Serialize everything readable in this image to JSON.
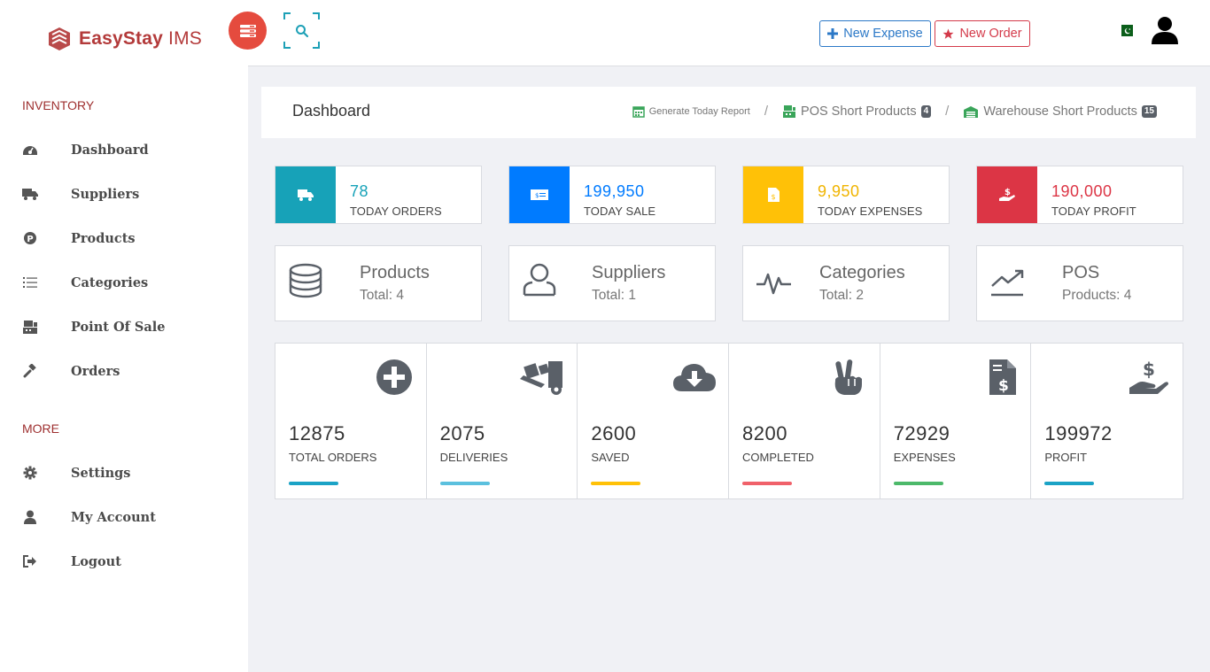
{
  "brand": {
    "name_part1": "EasyStay",
    "name_part2": " IMS"
  },
  "sidebar": {
    "section_inventory": "INVENTORY",
    "section_more": "MORE",
    "inventory_items": [
      {
        "label": "Dashboard",
        "icon": "dashboard-icon"
      },
      {
        "label": "Suppliers",
        "icon": "truck-icon"
      },
      {
        "label": "Products",
        "icon": "product-icon"
      },
      {
        "label": "Categories",
        "icon": "list-icon"
      },
      {
        "label": "Point Of Sale",
        "icon": "pos-icon"
      },
      {
        "label": "Orders",
        "icon": "gavel-icon"
      }
    ],
    "more_items": [
      {
        "label": "Settings",
        "icon": "gear-icon"
      },
      {
        "label": "My Account",
        "icon": "user-icon"
      },
      {
        "label": "Logout",
        "icon": "logout-icon"
      }
    ]
  },
  "header": {
    "new_expense": "New Expense",
    "new_order": "New Order"
  },
  "breadcrumb": {
    "title": "Dashboard",
    "generate_report": "Generate Today Report",
    "pos_short": "POS Short Products",
    "pos_short_count": "4",
    "warehouse_short": "Warehouse Short Products",
    "warehouse_short_count": "15"
  },
  "stats": [
    {
      "value": "78",
      "caption": "TODAY ORDERS",
      "color": "#17a2b8",
      "icon": "truck-icon"
    },
    {
      "value": "199,950",
      "caption": "TODAY SALE",
      "color": "#007bff",
      "icon": "money-icon"
    },
    {
      "value": "9,950",
      "caption": "TODAY EXPENSES",
      "color": "#ffc107",
      "icon": "invoice-icon"
    },
    {
      "value": "190,000",
      "caption": "TODAY PROFIT",
      "color": "#dc3545",
      "icon": "hand-dollar-icon"
    }
  ],
  "info_cards": [
    {
      "name": "Products",
      "sub": "Total: 4",
      "icon": "database-icon"
    },
    {
      "name": "Suppliers",
      "sub": "Total: 1",
      "icon": "user-outline-icon"
    },
    {
      "name": "Categories",
      "sub": "Total: 2",
      "icon": "pulse-icon"
    },
    {
      "name": "POS",
      "sub": "Products: 4",
      "icon": "trend-icon"
    }
  ],
  "metrics": [
    {
      "value": "12875",
      "caption": "TOTAL ORDERS",
      "color": "#1ba3c6",
      "icon": "plus-circle-icon"
    },
    {
      "value": "2075",
      "caption": "DELIVERIES",
      "color": "#5bc0de",
      "icon": "dolly-icon"
    },
    {
      "value": "2600",
      "caption": "SAVED",
      "color": "#ffc107",
      "icon": "cloud-download-icon"
    },
    {
      "value": "8200",
      "caption": "COMPLETED",
      "color": "#f0616a",
      "icon": "peace-hand-icon"
    },
    {
      "value": "72929",
      "caption": "EXPENSES",
      "color": "#4cb96a",
      "icon": "invoice-dollar-icon"
    },
    {
      "value": "199972",
      "caption": "PROFIT",
      "color": "#1ba3c6",
      "icon": "hand-dollar-icon"
    }
  ]
}
